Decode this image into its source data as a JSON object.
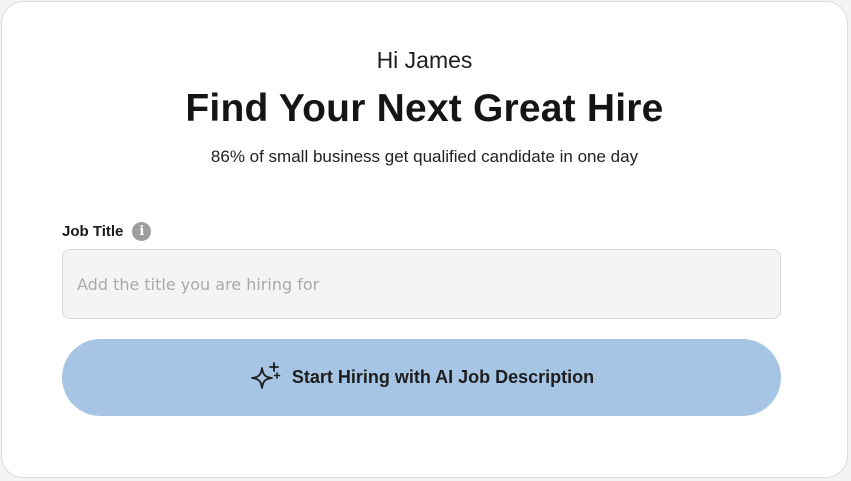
{
  "greeting": "Hi James",
  "headline": "Find Your Next Great Hire",
  "subline": "86% of small business get qualified candidate in one day",
  "job_title": {
    "label": "Job Title",
    "info_icon": "info-icon",
    "value": "",
    "placeholder": "Add the title you are hiring for"
  },
  "cta": {
    "icon": "sparkle-icon",
    "label": "Start Hiring with AI Job Description"
  },
  "colors": {
    "cta_background": "#a6c5e4",
    "input_background": "#f4f4f4",
    "info_icon": "#9e9e9e"
  }
}
